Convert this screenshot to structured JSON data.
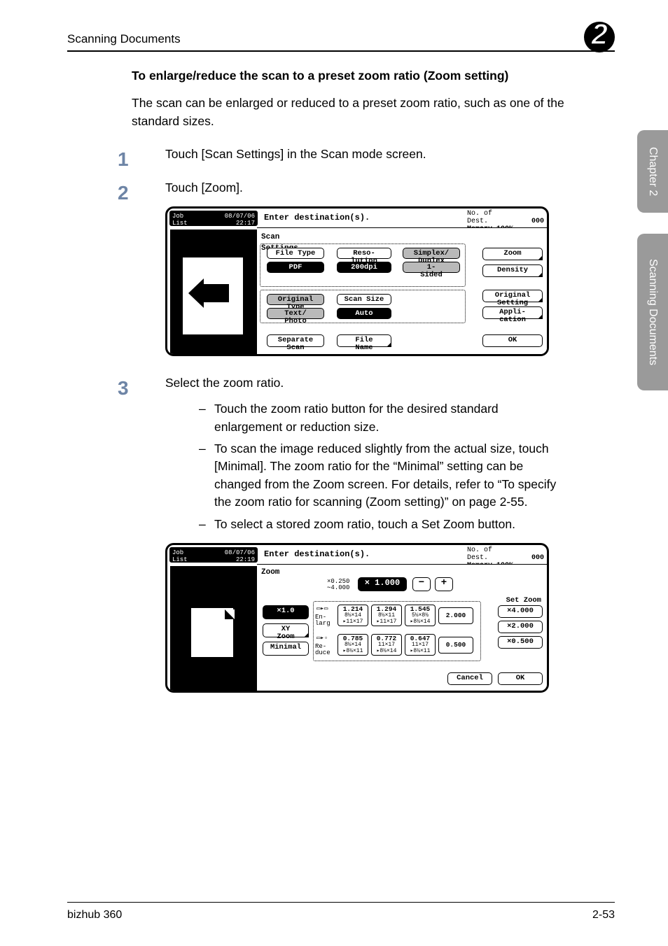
{
  "page": {
    "section_header": "Scanning Documents",
    "chapter_num": "2",
    "footer_left": "bizhub 360",
    "footer_right": "2-53",
    "sidetab_chapter": "Chapter 2",
    "sidetab_section": "Scanning Documents"
  },
  "text": {
    "heading": "To enlarge/reduce the scan to a preset zoom ratio (Zoom setting)",
    "intro": "The scan can be enlarged or reduced to a preset zoom ratio, such as one of the standard sizes.",
    "step1_num": "1",
    "step1": "Touch [Scan Settings] in the Scan mode screen.",
    "step2_num": "2",
    "step2": "Touch [Zoom].",
    "step3_num": "3",
    "step3": "Select the zoom ratio.",
    "step3_a": "Touch the zoom ratio button for the desired standard enlargement or reduction size.",
    "step3_b": "To scan the image reduced slightly from the actual size, touch [Minimal]. The zoom ratio for the “Minimal” setting can be changed from the Zoom screen. For details, refer to “To specify the zoom ratio for scanning (Zoom setting)” on page 2-55.",
    "step3_c": "To select a stored zoom ratio, touch a Set Zoom button."
  },
  "screen1": {
    "job_list": "Job\nList",
    "datetime": "08/07/06\n22:17",
    "enter_dest": "Enter destination(s).",
    "no_of_dest_lbl": "No. of\nDest.",
    "no_of_dest_val": "000",
    "memory": "Memory 100%",
    "scan_settings": "Scan\nSettings",
    "file_type": "File Type",
    "file_type_val": "PDF",
    "resolution": "Reso-\nlution",
    "resolution_val": "200dpi",
    "duplex": "Simplex/\nDuplex",
    "duplex_val": "1-\nSided",
    "orig_type": "Original\nType",
    "orig_type_val": "Text/\nPhoto",
    "scan_size": "Scan Size",
    "scan_size_val": "Auto",
    "separate_scan": "Separate\nScan",
    "file_name": "File\nName",
    "zoom": "Zoom",
    "density": "Density",
    "orig_setting": "Original\nSetting",
    "application": "Appli-\ncation",
    "ok": "OK"
  },
  "screen2": {
    "job_list": "Job\nList",
    "datetime": "08/07/06\n22:19",
    "enter_dest": "Enter destination(s).",
    "no_of_dest_lbl": "No. of\nDest.",
    "no_of_dest_val": "000",
    "memory": "Memory 100%",
    "zoom_label": "Zoom",
    "zoom_range": "×0.250\n∼4.000",
    "zoom_current": "× 1.000",
    "minus": "−",
    "plus": "+",
    "x10": "×1.0",
    "xy": "XY\nZoom",
    "minimal": "Minimal",
    "enlarge_lbl": "En-\nlarg",
    "reduce_lbl": "Re-\nduce",
    "set_zoom": "Set Zoom",
    "preset_x4": "×4.000",
    "preset_x2": "×2.000",
    "preset_x05": "×0.500",
    "cancel": "Cancel",
    "ok": "OK",
    "enlarge": {
      "c1": {
        "v": "1.214",
        "t": "8½×14\n▸11×17"
      },
      "c2": {
        "v": "1.294",
        "t": "8½×11\n▸11×17"
      },
      "c3": {
        "v": "1.545",
        "t": "5½×8½\n▸8½×14"
      },
      "c4": {
        "v": "2.000",
        "t": ""
      }
    },
    "reduce": {
      "c1": {
        "v": "0.785",
        "t": "8½×14\n▸8½×11"
      },
      "c2": {
        "v": "0.772",
        "t": "11×17\n▸8½×14"
      },
      "c3": {
        "v": "0.647",
        "t": "11×17\n▸8½×11"
      },
      "c4": {
        "v": "0.500",
        "t": ""
      }
    }
  }
}
